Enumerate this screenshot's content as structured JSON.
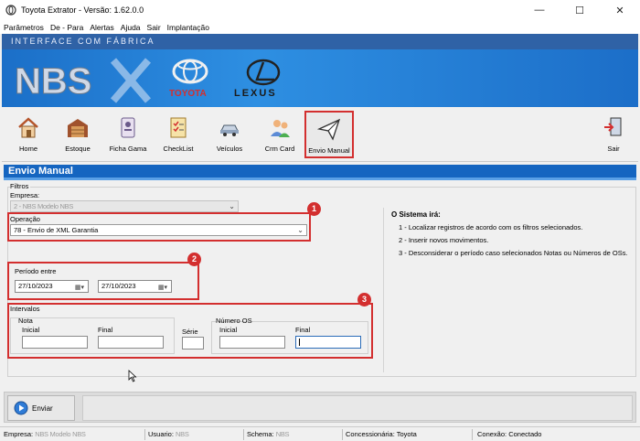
{
  "window": {
    "title": "Toyota Extrator - Versão: 1.62.0.0",
    "controls": {
      "minimize": "—",
      "maximize": "☐",
      "close": "✕"
    }
  },
  "menu": [
    "Parâmetros",
    "De - Para",
    "Alertas",
    "Ajuda",
    "Sair",
    "Implantação"
  ],
  "banner": {
    "strip_text": "INTERFACE COM FÁBRICA",
    "brands": [
      {
        "name": "NBS",
        "color": "#cfd8e6"
      },
      {
        "name": "TOYOTA",
        "color": "#d32f2f"
      },
      {
        "name": "LEXUS",
        "color": "#1b1b1b"
      }
    ]
  },
  "toolbar": {
    "items": [
      {
        "label": "Home",
        "icon": "home-icon"
      },
      {
        "label": "Estoque",
        "icon": "garage-icon"
      },
      {
        "label": "Ficha Gama",
        "icon": "id-card-icon"
      },
      {
        "label": "CheckList",
        "icon": "checklist-icon"
      },
      {
        "label": "Veículos",
        "icon": "vehicles-icon"
      },
      {
        "label": "Crm Card",
        "icon": "users-icon"
      },
      {
        "label": "Envio Manual",
        "icon": "paper-plane-icon",
        "active": true
      }
    ],
    "exit_label": "Sair"
  },
  "section_title": "Envio Manual",
  "form": {
    "filtros_label": "Filtros",
    "empresa_label": "Empresa:",
    "empresa_value": "2 - NBS Modelo NBS",
    "operacao_label": "Operação",
    "operacao_value": "78 - Envio de XML Garantia",
    "periodo_label": "Período entre",
    "date_start": "27/10/2023",
    "date_end": "27/10/2023",
    "intervalos_label": "Intervalos",
    "nota_label": "Nota",
    "inicial_label": "Inicial",
    "final_label": "Final",
    "serie_label": "Série",
    "numero_os_label": "Número OS",
    "os_inicial_label": "Inicial",
    "os_final_label": "Final"
  },
  "badges": [
    "1",
    "2",
    "3"
  ],
  "info": {
    "heading": "O Sistema irá:",
    "items": [
      "1 - Localizar registros de acordo com os filtros selecionados.",
      "2 - Inserir novos movimentos.",
      "3 - Desconsiderar o período caso selecionados Notas ou Números de OSs."
    ]
  },
  "actions": {
    "send_label": "Enviar"
  },
  "status": {
    "empresa_label": "Empresa:",
    "empresa_value": "NBS Modelo NBS",
    "usuario_label": "Usuario:",
    "usuario_value": "NBS",
    "schema_label": "Schema:",
    "schema_value": "NBS",
    "concessionaria": "Concessionária: Toyota",
    "conexao": "Conexão: Conectado"
  },
  "colors": {
    "accent_blue": "#1565c0",
    "annotation_red": "#d32f2f"
  }
}
